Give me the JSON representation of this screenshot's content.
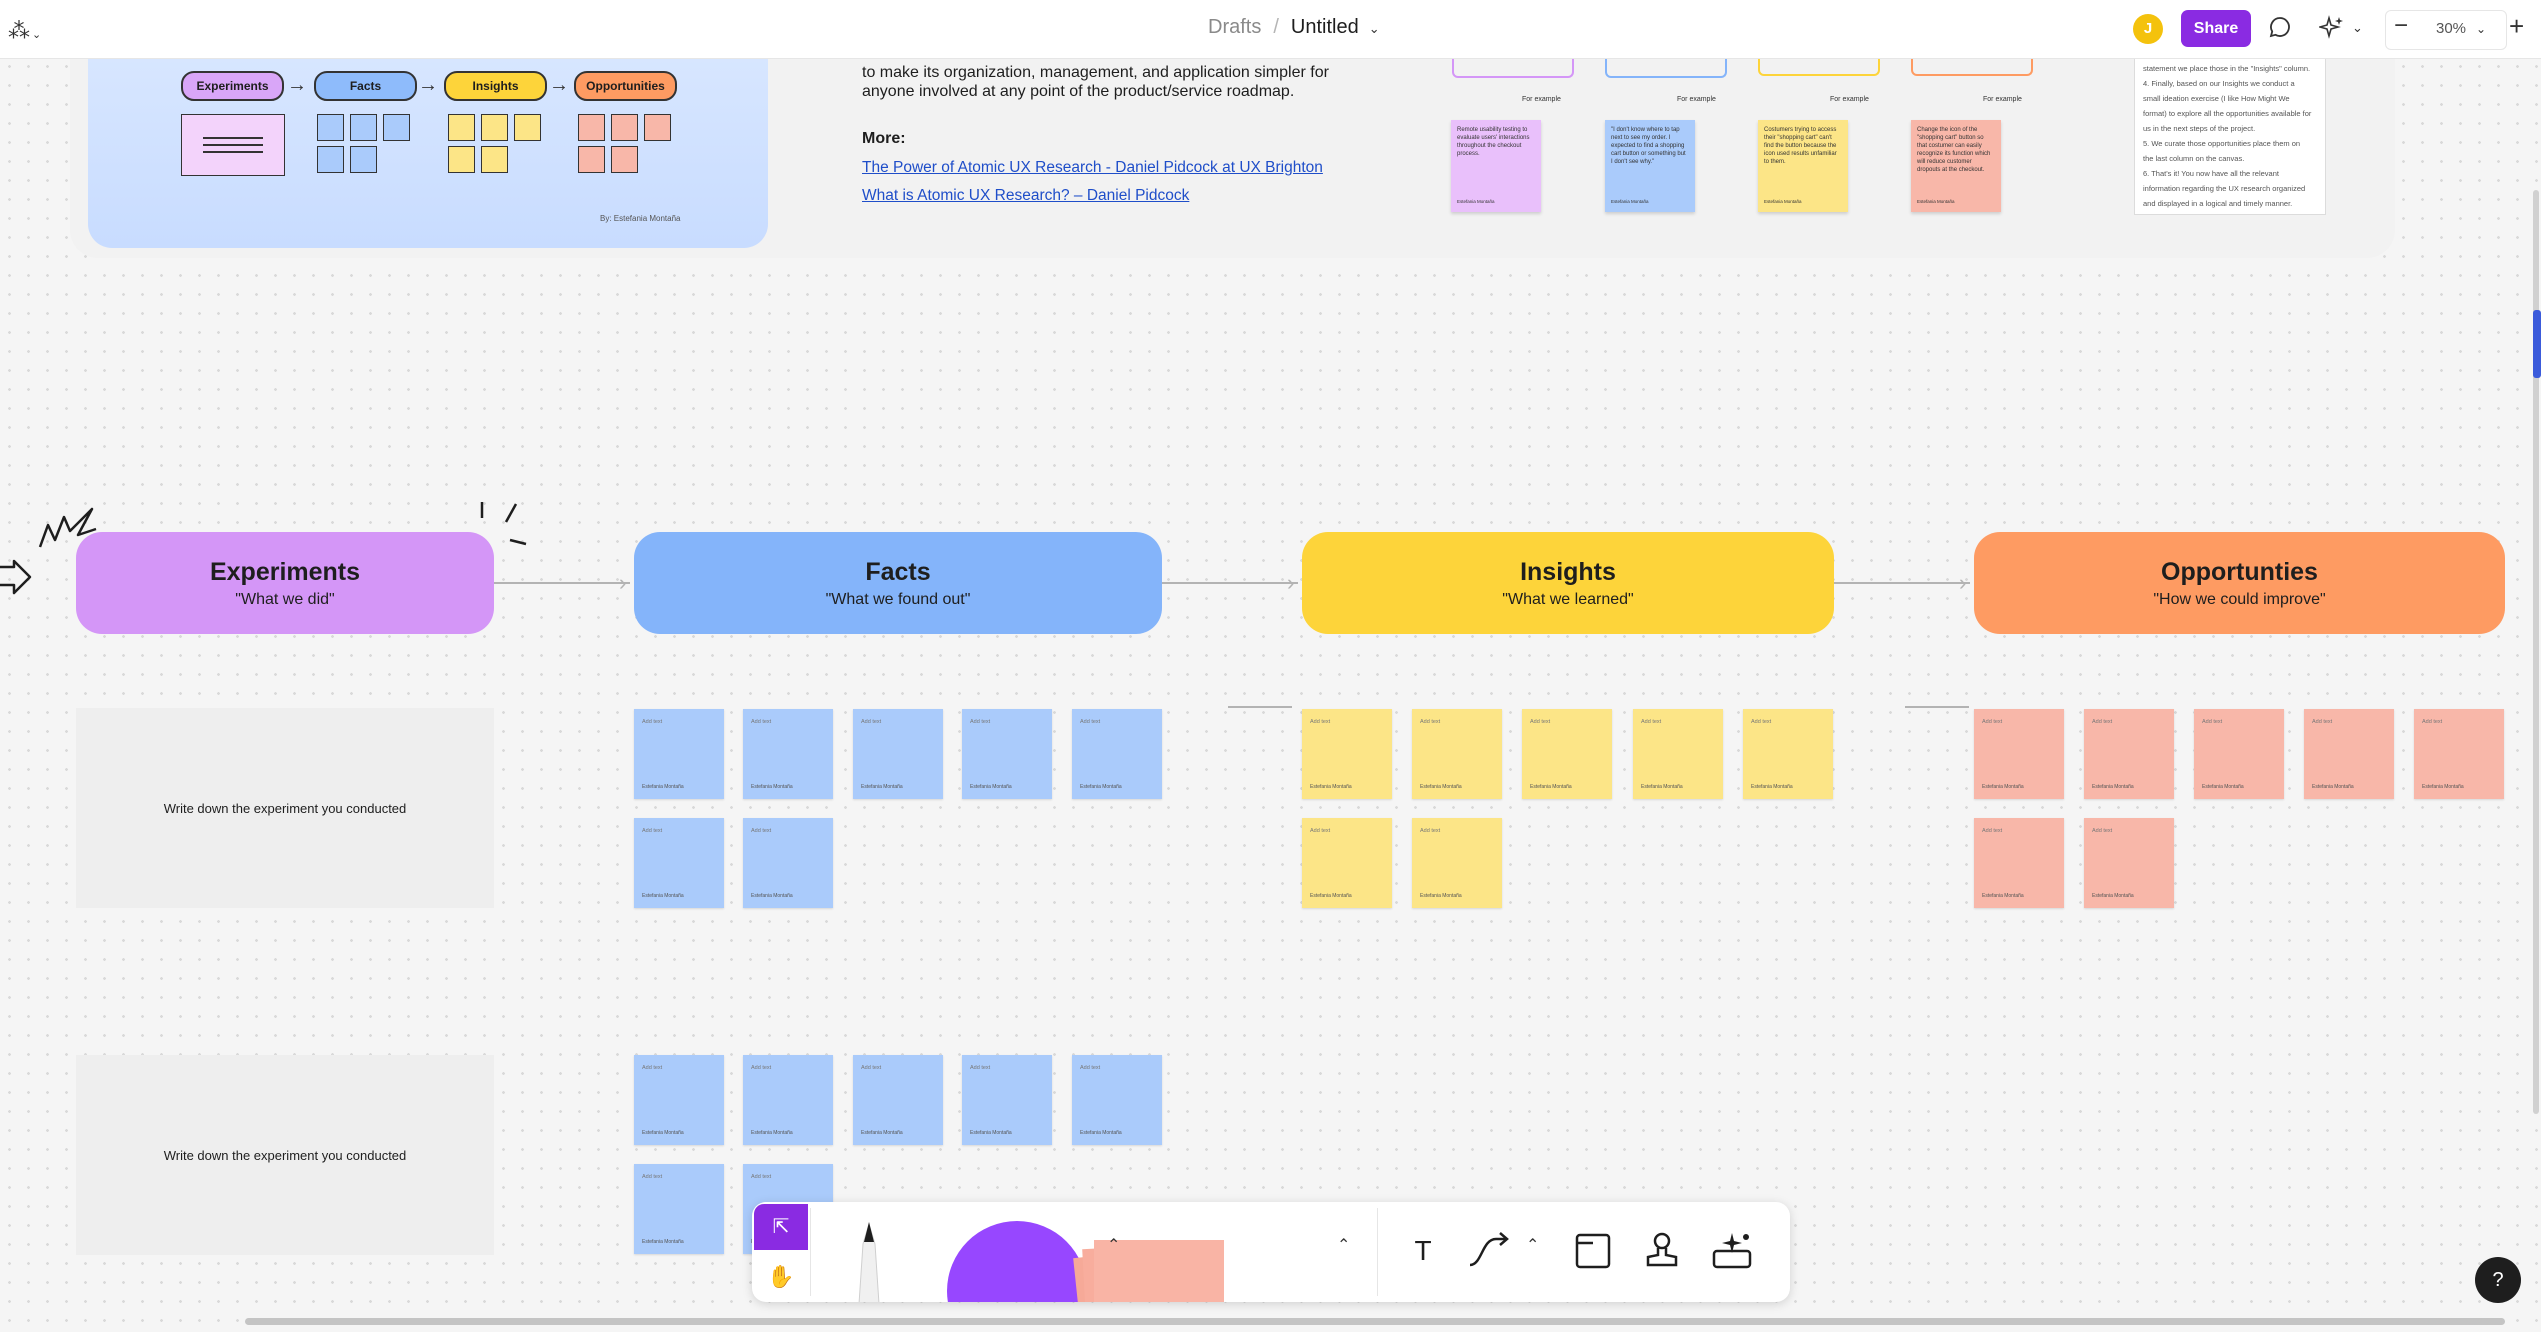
{
  "topbar": {
    "breadcrumb_parent": "Drafts",
    "breadcrumb_sep": "/",
    "file_name": "Untitled",
    "avatar_initial": "J",
    "share_label": "Share",
    "zoom_level": "30%"
  },
  "reference": {
    "mini_pills": [
      "Experiments",
      "Facts",
      "Insights",
      "Opportunities"
    ],
    "credit": "By: Estefania Montaña",
    "description": "to make its organization, management, and application simpler for anyone involved at any point of the product/service roadmap.",
    "more_label": "More:",
    "links": [
      "The Power of Atomic UX Research - Daniel Pidcock at UX Brighton",
      "What is Atomic UX Research? – Daniel Pidcock"
    ],
    "for_example_label": "For example",
    "example_cards": [
      "Remote usability testing to evaluate users' interactions throughout the checkout process.",
      "\"I don't know where to tap next to see my order. I expected to find a shopping cart button or something but I don't see why.\"",
      "Costumers trying to access their \"shopping cart\" can't find the button because the icon used results unfamiliar to them.",
      "Change the icon of the \"shopping cart\" button so that costumer can easily recognize its function which will reduce customer dropouts at the checkout."
    ],
    "example_author": "Estefania Montaña",
    "doc_lines": [
      "statement we place those in the \"Insights\" column.",
      "4. Finally, based on our Insights we conduct a",
      "small ideation exercise (I like How Might We",
      "format) to explore all the opportunities available for",
      "us in the next steps of the project.",
      "5. We curate those opportunities place them on",
      "the last column on the canvas.",
      "6. That's it! You now have all the relevant",
      "information regarding the UX research organized",
      "and displayed in a logical and timely manner."
    ]
  },
  "columns": [
    {
      "title": "Experiments",
      "subtitle": "\"What we did\"",
      "color": "#d496f7"
    },
    {
      "title": "Facts",
      "subtitle": "\"What we found out\"",
      "color": "#84b4fa"
    },
    {
      "title": "Insights",
      "subtitle": "\"What we learned\"",
      "color": "#fdd43a"
    },
    {
      "title": "Opportunties",
      "subtitle": "\"How we could improve\"",
      "color": "#fe9b62"
    }
  ],
  "experiment_placeholder": "Write down the experiment you conducted",
  "sticky": {
    "placeholder": "Add text",
    "author": "Estefania Montaña"
  },
  "colors": {
    "accent": "#8a2be2",
    "sticky_blue": "#aacbfb",
    "sticky_yellow": "#fce587",
    "sticky_salmon": "#f8b7a9"
  },
  "toolbar": {
    "tools": [
      "move-tool",
      "hand-tool",
      "pen-tool",
      "shape-tool",
      "sticky-tool",
      "text-tool",
      "connector-tool",
      "section-tool",
      "stamp-tool",
      "actions-tool"
    ]
  },
  "help_label": "?"
}
